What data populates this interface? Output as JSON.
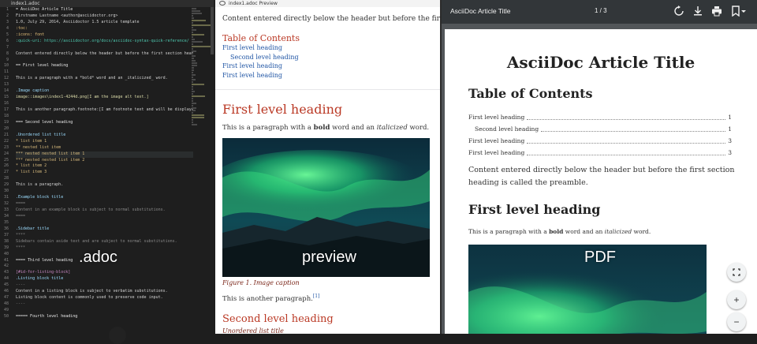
{
  "editor": {
    "tab_title": "index1.adoc",
    "overlay_label": ".adoc",
    "lines": [
      {
        "n": "1",
        "text": "= AsciiDoc Article Title",
        "c": "c-heading"
      },
      {
        "n": "2",
        "text": "Firstname Lastname <author@asciidoctor.org>",
        "c": "c-default"
      },
      {
        "n": "3",
        "text": "1.0, July 29, 2014, Asciidoctor 1.5 article template",
        "c": "c-default"
      },
      {
        "n": "4",
        "text": ":toc:",
        "c": "c-attr"
      },
      {
        "n": "5",
        "text": ":icons: font",
        "c": "c-attr"
      },
      {
        "n": "6",
        "text": ":quick-uri: https://asciidoctor.org/docs/asciidoc-syntax-quick-reference/",
        "c": "c-link"
      },
      {
        "n": "7",
        "text": "",
        "c": "c-default"
      },
      {
        "n": "8",
        "text": "Content entered directly below the header but before the first section heading is called the preamble.",
        "c": "c-default"
      },
      {
        "n": "9",
        "text": "",
        "c": "c-default"
      },
      {
        "n": "10",
        "text": "== First level heading",
        "c": "c-heading"
      },
      {
        "n": "11",
        "text": "",
        "c": "c-default"
      },
      {
        "n": "12",
        "text": "This is a paragraph with a *bold* word and an _italicized_ word.",
        "c": "c-default"
      },
      {
        "n": "13",
        "text": "",
        "c": "c-default"
      },
      {
        "n": "14",
        "text": ".Image caption",
        "c": "c-block"
      },
      {
        "n": "15",
        "text": "image::images\\index1-4244d.png[I am the image alt text.]",
        "c": "c-val"
      },
      {
        "n": "16",
        "text": "",
        "c": "c-default"
      },
      {
        "n": "17",
        "text": "This is another paragraph.footnote:[I am footnote text and will be displayed at the bottom of the article.]",
        "c": "c-default"
      },
      {
        "n": "18",
        "text": "",
        "c": "c-default"
      },
      {
        "n": "19",
        "text": "=== Second level heading",
        "c": "c-heading"
      },
      {
        "n": "20",
        "text": "",
        "c": "c-default"
      },
      {
        "n": "21",
        "text": ".Unordered list title",
        "c": "c-block"
      },
      {
        "n": "22",
        "text": "* list item 1",
        "c": "c-list"
      },
      {
        "n": "23",
        "text": "** nested list item",
        "c": "c-list"
      },
      {
        "n": "24",
        "text": "*** nested nested list item 1",
        "c": "c-list"
      },
      {
        "n": "25",
        "text": "*** nested nested list item 2",
        "c": "c-list"
      },
      {
        "n": "26",
        "text": "* list item 2",
        "c": "c-list"
      },
      {
        "n": "27",
        "text": "* list item 3",
        "c": "c-list"
      },
      {
        "n": "28",
        "text": "",
        "c": "c-default"
      },
      {
        "n": "29",
        "text": "This is a paragraph.",
        "c": "c-default"
      },
      {
        "n": "30",
        "text": "",
        "c": "c-default"
      },
      {
        "n": "31",
        "text": ".Example block title",
        "c": "c-block"
      },
      {
        "n": "32",
        "text": "====",
        "c": "c-delim"
      },
      {
        "n": "33",
        "text": "Content in an example block is subject to normal substitutions.",
        "c": "c-comment"
      },
      {
        "n": "34",
        "text": "====",
        "c": "c-delim"
      },
      {
        "n": "35",
        "text": "",
        "c": "c-default"
      },
      {
        "n": "36",
        "text": ".Sidebar title",
        "c": "c-block"
      },
      {
        "n": "37",
        "text": "****",
        "c": "c-delim"
      },
      {
        "n": "38",
        "text": "Sidebars contain aside text and are subject to normal substitutions.",
        "c": "c-comment"
      },
      {
        "n": "39",
        "text": "****",
        "c": "c-delim"
      },
      {
        "n": "40",
        "text": "",
        "c": "c-default"
      },
      {
        "n": "41",
        "text": "==== Third level heading",
        "c": "c-heading"
      },
      {
        "n": "42",
        "text": "",
        "c": "c-default"
      },
      {
        "n": "43",
        "text": "[#id-for-listing-block]",
        "c": "c-macro"
      },
      {
        "n": "44",
        "text": ".Listing block title",
        "c": "c-block"
      },
      {
        "n": "45",
        "text": "----",
        "c": "c-delim"
      },
      {
        "n": "46",
        "text": "Content in a listing block is subject to verbatim substitutions.",
        "c": "c-default"
      },
      {
        "n": "47",
        "text": "Listing block content is commonly used to preserve code input.",
        "c": "c-default"
      },
      {
        "n": "48",
        "text": "----",
        "c": "c-delim"
      },
      {
        "n": "49",
        "text": "",
        "c": "c-default"
      },
      {
        "n": "50",
        "text": "===== Fourth level heading",
        "c": "c-heading"
      }
    ]
  },
  "preview": {
    "tab_title": "index1.adoc Preview",
    "overlay_label": "preview",
    "intro": "Content entered directly below the header but before the first section",
    "toc_title": "Table of Contents",
    "toc": [
      {
        "label": "First level heading",
        "sub": false
      },
      {
        "label": "Second level heading",
        "sub": true
      },
      {
        "label": "First level heading",
        "sub": false
      },
      {
        "label": "First level heading",
        "sub": false
      }
    ],
    "h1": "First level heading",
    "para_pre": "This is a paragraph with a ",
    "para_bold": "bold",
    "para_mid": " word and an ",
    "para_italic": "italicized",
    "para_post": " word.",
    "caption": "Figure 1. Image caption",
    "para2": "This is another paragraph.",
    "footnote_ref": "[1]",
    "h2": "Second level heading",
    "ul_title": "Unordered list title"
  },
  "pdf": {
    "title": "AsciiDoc Article Title",
    "page_indicator": "1 / 3",
    "overlay_label": "PDF",
    "doc_title": "AsciiDoc Article Title",
    "toc_title": "Table of Contents",
    "toc": [
      {
        "label": "First level heading",
        "page": "1",
        "sub": false
      },
      {
        "label": "Second level heading",
        "page": "1",
        "sub": true
      },
      {
        "label": "First level heading",
        "page": "3",
        "sub": false
      },
      {
        "label": "First level heading",
        "page": "3",
        "sub": false
      }
    ],
    "preamble": "Content entered directly below the header but before the first section heading is called the preamble.",
    "h1": "First level heading",
    "para_pre": "This is a paragraph with a ",
    "para_bold": "bold",
    "para_mid": " word and an ",
    "para_italic": "italicized",
    "para_post": " word.",
    "icons": [
      "rotate-icon",
      "download-icon",
      "print-icon",
      "bookmark-icon"
    ],
    "fab_fit": "fit-page-icon",
    "fab_zoom_in": "+",
    "fab_zoom_out": "−"
  },
  "colors": {
    "editor_bg": "#1e1e1e",
    "heading_red": "#ba3925",
    "link_blue": "#2156a5",
    "pdf_bg": "#525659",
    "pdf_toolbar": "#323639"
  }
}
